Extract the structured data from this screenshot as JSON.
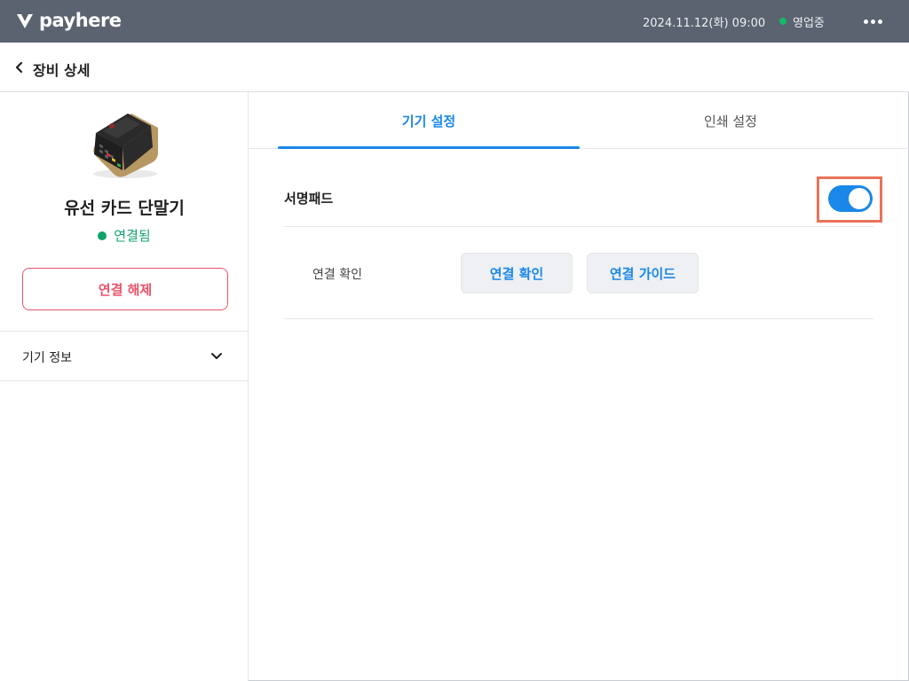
{
  "topbar": {
    "brand": "payhere",
    "datetime": "2024.11.12(화) 09:00",
    "status": "영업중",
    "status_color": "#14b866",
    "more_icon": "more-dots-icon"
  },
  "header": {
    "title": "장비 상세",
    "back_icon": "chevron-left-icon"
  },
  "device": {
    "name": "유선 카드 단말기",
    "connection_status": "연결됨",
    "disconnect_label": "연결 해제",
    "info_label": "기기 정보",
    "info_icon": "chevron-down-icon"
  },
  "tabs": [
    {
      "label": "기기 설정",
      "active": true
    },
    {
      "label": "인쇄 설정",
      "active": false
    }
  ],
  "settings": {
    "signature_pad_label": "서명패드",
    "signature_pad_enabled": true,
    "connection_check_label": "연결 확인",
    "check_button_label": "연결 확인",
    "guide_button_label": "연결 가이드"
  },
  "colors": {
    "accent": "#1a88e8",
    "danger": "#e8546a",
    "connected": "#12a26b",
    "topbar": "#5b6270",
    "highlight": "#e87358"
  }
}
